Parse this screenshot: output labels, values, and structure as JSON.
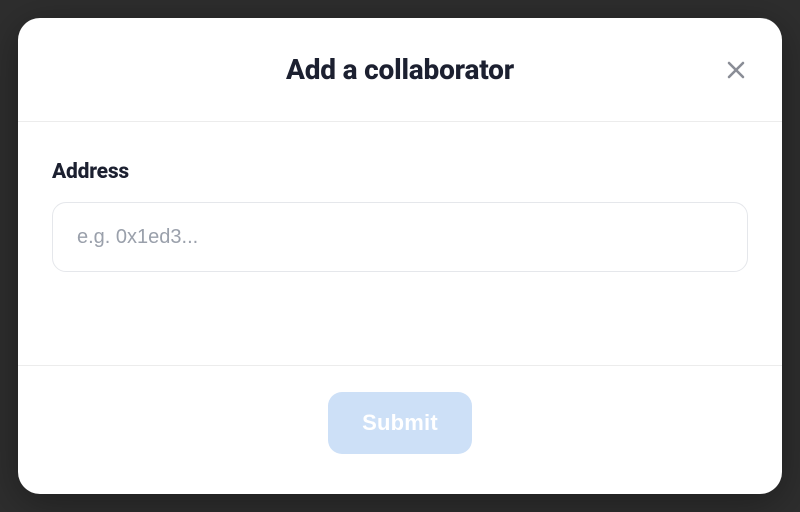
{
  "modal": {
    "title": "Add a collaborator",
    "close_icon": "close-icon",
    "address": {
      "label": "Address",
      "value": "",
      "placeholder": "e.g. 0x1ed3..."
    },
    "submit_label": "Submit"
  }
}
